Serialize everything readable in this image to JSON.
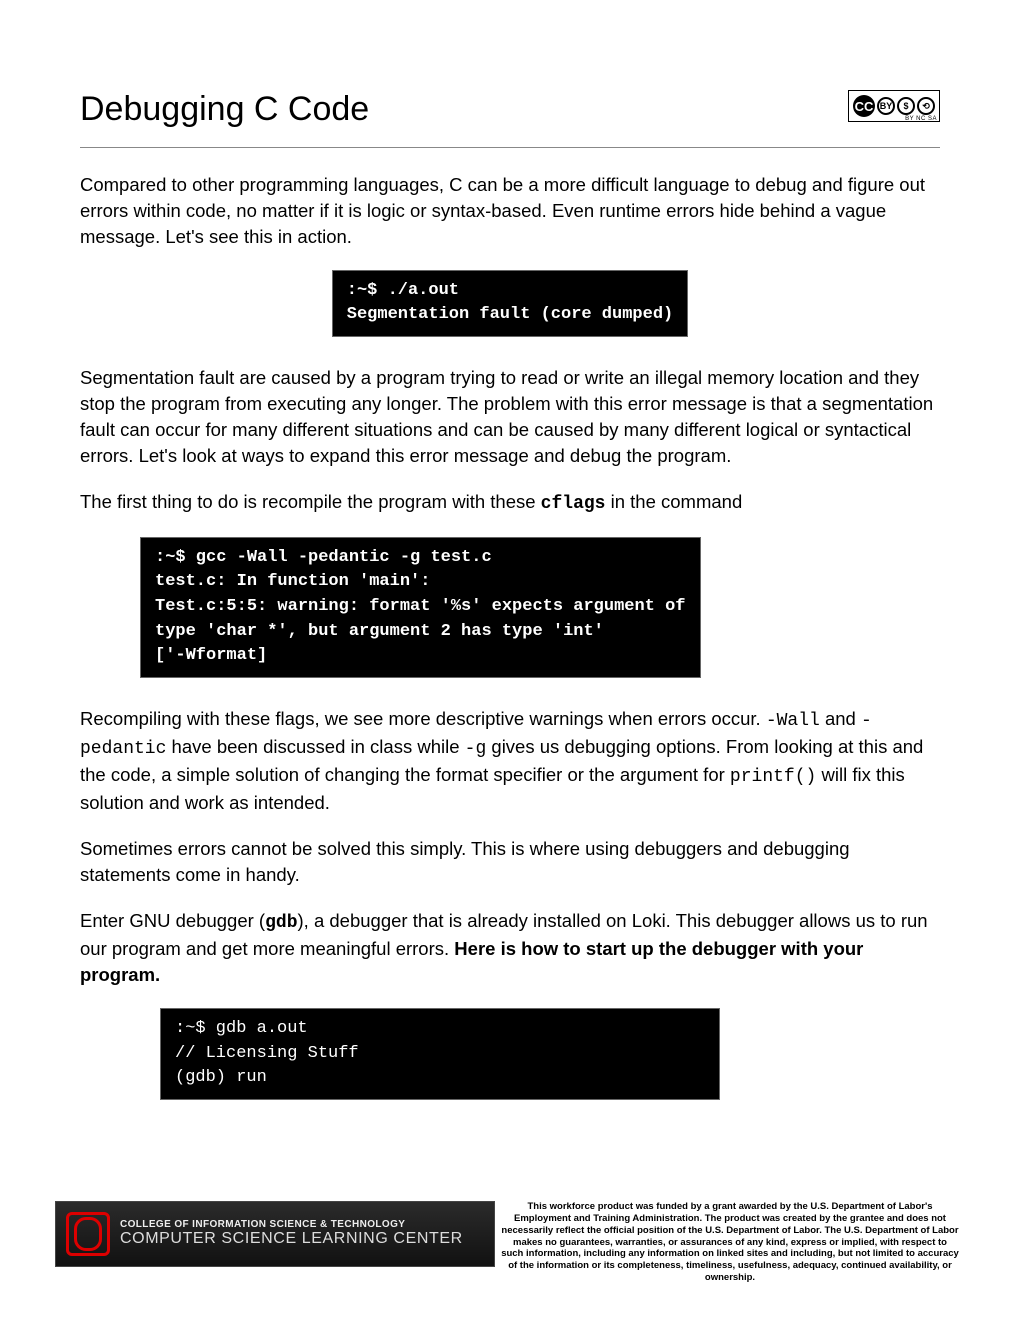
{
  "header": {
    "title": "Debugging C Code",
    "cc": {
      "label": "CC",
      "sub": "BY   NC   SA"
    }
  },
  "body": {
    "p1": "Compared to other programming languages, C can be  a more difficult language to debug and figure out errors within code, no matter if it is logic or syntax-based. Even runtime errors hide behind a vague message. Let's see this in action.",
    "term1": ":~$ ./a.out\nSegmentation fault (core dumped)",
    "p2": "Segmentation fault are caused by a program trying to read or write an illegal memory location and they stop the program from executing any longer. The problem with this error message is that a segmentation fault can occur for many different situations and can be caused by many different logical or syntactical errors. Let's look at ways to expand this error message and debug the program.",
    "p3a": "The first thing to do is recompile the program with these ",
    "p3_code": "cflags",
    "p3b": " in the command",
    "term2": ":~$ gcc -Wall -pedantic -g test.c\ntest.c: In function 'main':\nTest.c:5:5: warning: format '%s' expects argument of\ntype 'char *', but argument 2 has type 'int'\n['-Wformat]",
    "p4a": "Recompiling with these flags, we see more descriptive warnings when errors occur. ",
    "p4_code1": "-Wall",
    "p4b": "  and ",
    "p4_code2": "-pedantic",
    "p4c": " have been discussed in class while  ",
    "p4_code3": "-g",
    "p4d": "  gives us debugging options. From looking at this and the code, a simple solution of changing the format specifier or the argument for ",
    "p4_code4": "printf()",
    "p4e": " will fix this solution and work as intended.",
    "p5": "Sometimes errors cannot be solved this simply. This is where using debuggers and debugging statements come in handy.",
    "p6a": "Enter GNU debugger (",
    "p6_code": "gdb",
    "p6b": "),  a debugger that is already installed on Loki. This debugger allows us to run our program and get more meaningful errors. ",
    "p6_strong": "Here is how to start up the debugger with your program.",
    "term3": ":~$ gdb a.out\n// Licensing Stuff\n(gdb) run"
  },
  "footer": {
    "logo_line1": "COLLEGE OF INFORMATION SCIENCE & TECHNOLOGY",
    "logo_line2": "COMPUTER SCIENCE LEARNING CENTER",
    "disclaimer": "This workforce product was funded by a grant awarded by the U.S. Department of Labor's Employment and Training Administration. The product was created by the grantee and does not necessarily reflect the official position of the U.S. Department of Labor. The U.S. Department of Labor makes no guarantees, warranties, or assurances of any kind, express or implied, with respect to such information, including any information on linked sites and including, but not limited to accuracy of the information or its completeness, timeliness, usefulness, adequacy, continued availability, or ownership."
  }
}
